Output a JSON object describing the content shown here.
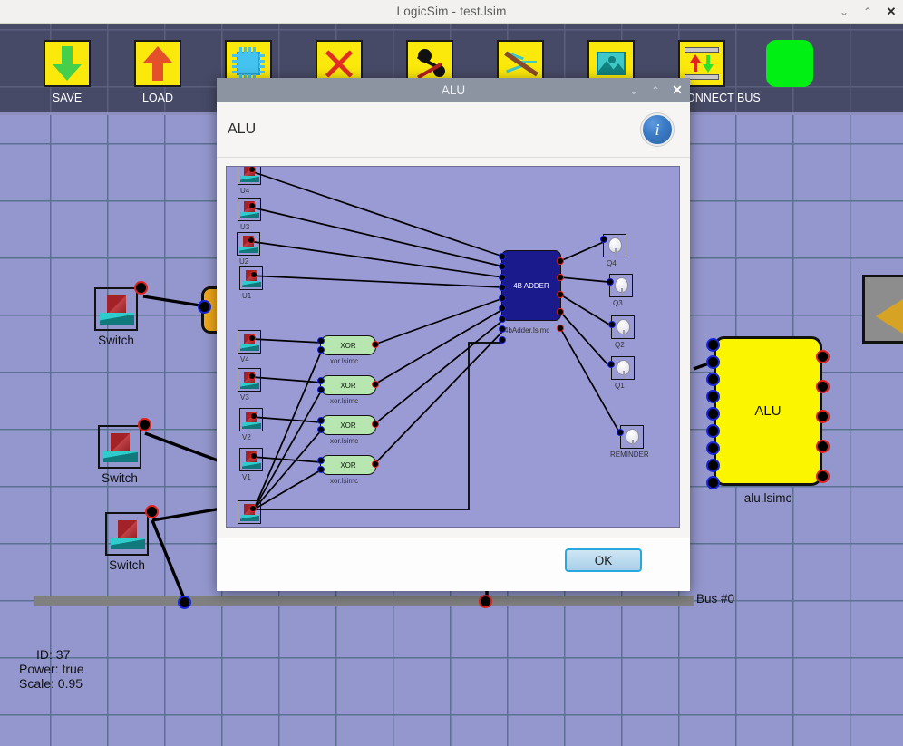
{
  "window": {
    "title": "LogicSim - test.lsim",
    "controls": {
      "minimize": "⌄",
      "maximize": "⌃",
      "close": "✕"
    }
  },
  "toolbar": {
    "items": [
      {
        "label": "SAVE",
        "icon": "down-arrow-icon"
      },
      {
        "label": "LOAD",
        "icon": "up-arrow-icon"
      },
      {
        "label": "",
        "icon": "chip-icon"
      },
      {
        "label": "",
        "icon": "delete-x-icon"
      },
      {
        "label": "",
        "icon": "disconnect-plug-icon"
      },
      {
        "label": "",
        "icon": "cut-wire-icon"
      },
      {
        "label": "",
        "icon": "image-icon"
      },
      {
        "label": "CONNECT BUS",
        "icon": "connect-bus-icon"
      },
      {
        "label": "",
        "icon": "power-indicator"
      }
    ],
    "power_color": "#00f014",
    "button_color": "#fbe90b"
  },
  "canvas": {
    "background_color": "#9497ce",
    "grid_color": "#5b7191",
    "switches": [
      {
        "label": "Switch"
      },
      {
        "label": "Switch"
      },
      {
        "label": "Switch"
      }
    ],
    "alu": {
      "title": "ALU",
      "file": "alu.lsimc",
      "inputs": 9,
      "outputs": 5,
      "color": "#fbf500"
    },
    "bus": {
      "label": "Bus #0",
      "color": "#808080"
    },
    "status": {
      "id": "ID: 37",
      "power": "Power: true",
      "scale": "Scale: 0.95"
    },
    "side_panel": {
      "icon": "left-triangle-icon",
      "color": "#d6a325"
    }
  },
  "dialog": {
    "titlebar": {
      "title": "ALU",
      "minimize": "⌄",
      "maximize": "⌃",
      "close": "✕"
    },
    "heading": "ALU",
    "info_icon": "i",
    "ok_label": "OK",
    "circuit": {
      "background_color": "#9a9ad4",
      "upper_switches": [
        {
          "label": "U4"
        },
        {
          "label": "U3"
        },
        {
          "label": "U2"
        },
        {
          "label": "U1"
        }
      ],
      "lower_switches": [
        {
          "label": "V4"
        },
        {
          "label": "V3"
        },
        {
          "label": "V2"
        },
        {
          "label": "V1"
        },
        {
          "label": ""
        }
      ],
      "xor_gates": [
        {
          "title": "XOR",
          "file": "xor.lsimc"
        },
        {
          "title": "XOR",
          "file": "xor.lsimc"
        },
        {
          "title": "XOR",
          "file": "xor.lsimc"
        },
        {
          "title": "XOR",
          "file": "xor.lsimc"
        }
      ],
      "adder": {
        "title": "4B ADDER",
        "file": "4bAdder.lsimc",
        "color": "#1a1a8c"
      },
      "leds": [
        {
          "label": "Q4"
        },
        {
          "label": "Q3"
        },
        {
          "label": "Q2"
        },
        {
          "label": "Q1"
        },
        {
          "label": "REMINDER"
        }
      ]
    }
  }
}
